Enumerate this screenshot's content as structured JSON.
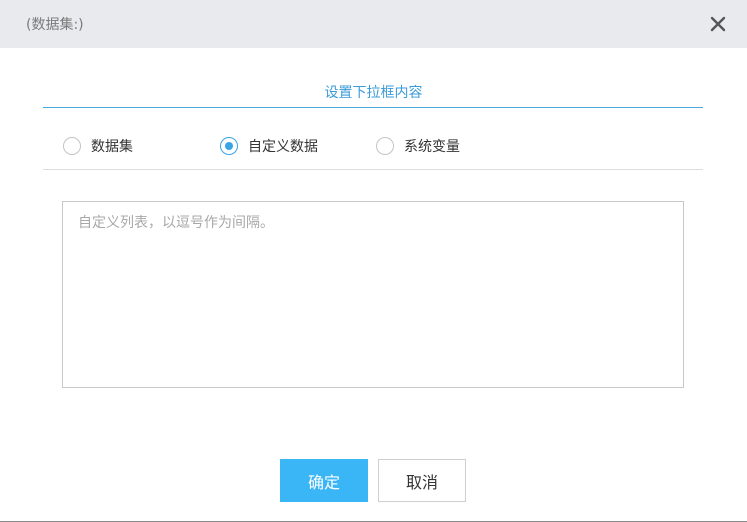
{
  "dialog": {
    "title": "(数据集:)",
    "close_icon": "close-icon"
  },
  "section": {
    "title": "设置下拉框内容"
  },
  "source_options": [
    {
      "label": "数据集",
      "selected": false
    },
    {
      "label": "自定义数据",
      "selected": true
    },
    {
      "label": "系统变量",
      "selected": false
    }
  ],
  "custom_list": {
    "value": "",
    "placeholder": "自定义列表，以逗号作为间隔。"
  },
  "buttons": {
    "ok_label": "确定",
    "cancel_label": "取消"
  },
  "colors": {
    "accent": "#3aa4e6",
    "primary_button": "#3ab5f5",
    "titlebar_bg": "#e8eaed"
  }
}
